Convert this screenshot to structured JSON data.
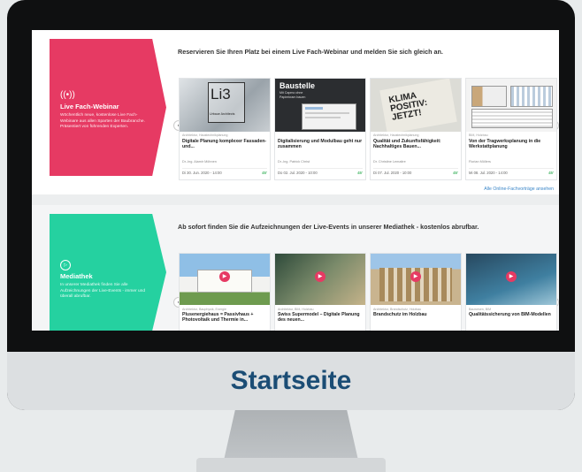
{
  "caption": "Startseite",
  "webinar": {
    "icon": "((•))",
    "title": "Live Fach-Webinar",
    "text": "Wöchentlich neue, kostenlose Live Fach-Webinare aus allen Sparten der Baubranche. Präsentiert von führenden Experten.",
    "heading": "Reservieren Sie Ihren Platz bei einem Live Fach-Webinar und melden Sie sich gleich an.",
    "link": "Alle Online-Fachvorträge ansehen",
    "cards": [
      {
        "image_text": "Li3",
        "image_sub": "Urbaue Architects",
        "category": "Architektur, Haustechnikplanung",
        "title": "Digitale Planung komplexer Fassaden- und...",
        "speaker": "Dr.-Ing. Alamir Möhnen",
        "date": "Di 30. Jun. 2020 - 14:00",
        "duration": "45'"
      },
      {
        "image_text": "Baustelle",
        "image_sub": "Mit Capmo ohne Papierkram bauen",
        "category": "",
        "title": "Digitalisierung und Modulbau geht nur zusammen",
        "speaker": "Dr.-Ing. Patrick Christ",
        "date": "Do 02. Jul. 2020 - 10:00",
        "duration": "45'"
      },
      {
        "image_text": "KLIMA POSITIV: JETZT!",
        "image_sub": "",
        "category": "Architektur, Haustechnikplanung",
        "title": "Qualität und Zukunftsfähigkeit: Nachhaltiges Bauen...",
        "speaker": "Dr. Christine Lemaitre",
        "date": "Di 07. Jul. 2020 - 10:00",
        "duration": "45'"
      },
      {
        "image_text": "",
        "image_sub": "",
        "category": "BIM, Holzbau",
        "title": "Von der Tragwerksplanung in die Werkstattplanung",
        "speaker": "Florian Möllers",
        "date": "Mi 08. Jul. 2020 - 14:00",
        "duration": "45'"
      }
    ]
  },
  "mediathek": {
    "icon": "▷",
    "title": "Mediathek",
    "text": "In unserer Mediathek finden Sie alle Aufzeichnungen der Live-Events - immer und überall abrufbar.",
    "heading": "Ab sofort finden Sie die Aufzeichnungen der Live-Events in unserer Mediathek - kostenlos abrufbar.",
    "cards": [
      {
        "category": "Architektur, Bauphysik, Energie",
        "title": "Plusenergiehaus = Passivhaus + Photovoltaik und Thermie in..."
      },
      {
        "category": "Architektur, BIM, Holzbau",
        "title": "Swiss Supermodel – Digitale Planung des neuen..."
      },
      {
        "category": "Architektur, Brandschutz, Holzbau",
        "title": "Brandschutz im Holzbau"
      },
      {
        "category": "Bauwesen, BIM",
        "title": "Qualitätssicherung von BIM-Modellen"
      }
    ]
  },
  "colors": {
    "webinar": "#e63a63",
    "mediathek": "#25d1a0",
    "caption": "#1b4d75"
  },
  "arrows": {
    "prev": "‹",
    "next": "›"
  }
}
